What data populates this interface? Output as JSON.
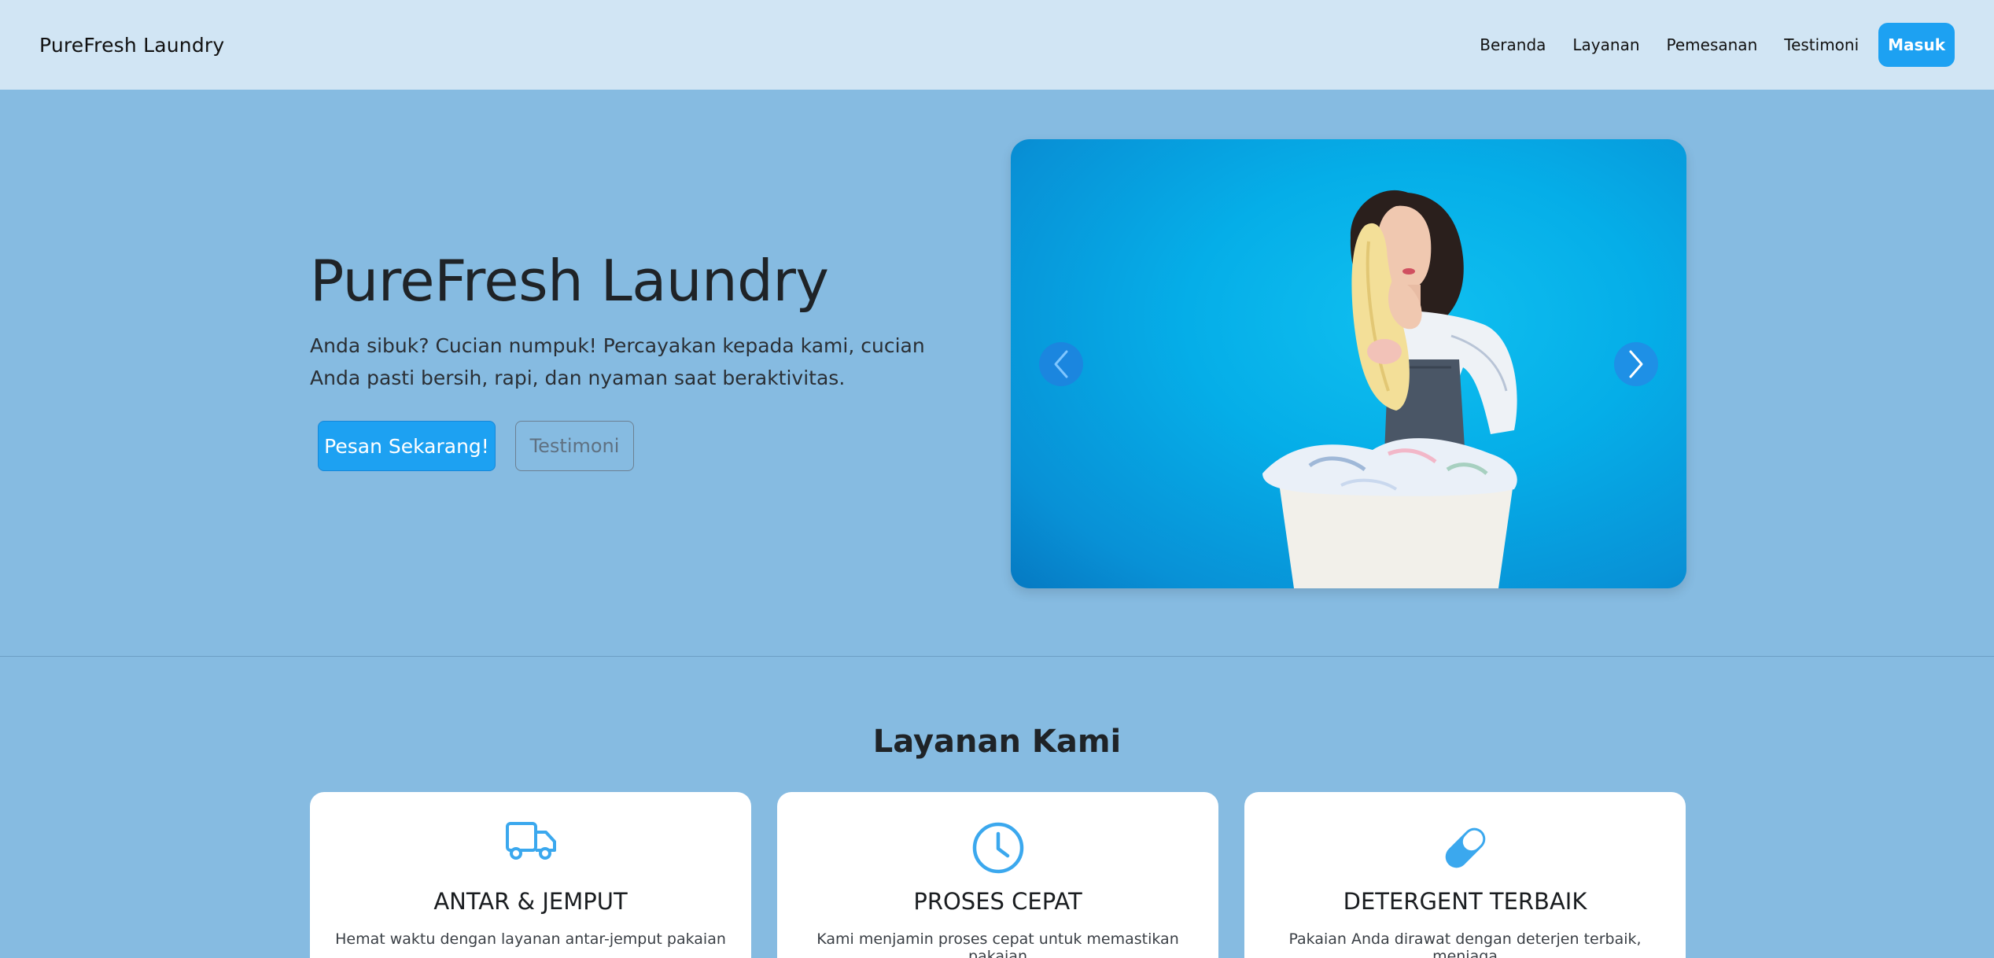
{
  "navbar": {
    "brand": "PureFresh Laundry",
    "links": [
      "Beranda",
      "Layanan",
      "Pemesanan",
      "Testimoni"
    ],
    "login_label": "Masuk",
    "accent_color": "#1da1f2"
  },
  "hero": {
    "title": "PureFresh Laundry",
    "description": "Anda sibuk? Cucian numpuk! Percayakan kepada kami, cucian Anda pasti bersih, rapi, dan nyaman saat beraktivitas.",
    "primary_button": "Pesan Sekarang!",
    "secondary_button": "Testimoni"
  },
  "carousel": {
    "prev_icon": "chevron-left-icon",
    "next_icon": "chevron-right-icon",
    "image_description_icon": "laundry-woman-photo"
  },
  "services": {
    "title": "Layanan Kami",
    "cards": [
      {
        "icon": "truck-icon",
        "title": "ANTAR & JEMPUT",
        "text": "Hemat waktu dengan layanan antar-jemput pakaian"
      },
      {
        "icon": "clock-icon",
        "title": "PROSES CEPAT",
        "text": "Kami menjamin proses cepat untuk memastikan pakaian"
      },
      {
        "icon": "capsule-icon",
        "title": "DETERGENT TERBAIK",
        "text": "Pakaian Anda dirawat dengan deterjen terbaik, menjaga"
      }
    ]
  },
  "colors": {
    "page_bg": "#86bbe1",
    "navbar_bg": "#d1e5f4",
    "icon_blue": "#3ba8ee"
  }
}
